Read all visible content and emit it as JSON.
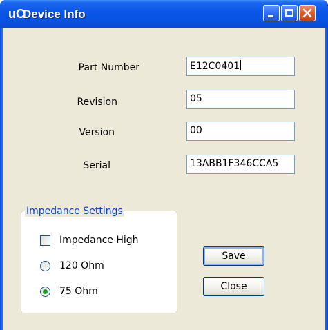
{
  "window": {
    "icon_text": "uC",
    "title": "Device Info"
  },
  "fields": {
    "part_number": {
      "label": "Part Number",
      "value": "E12C0401"
    },
    "revision": {
      "label": "Revision",
      "value": "05"
    },
    "version": {
      "label": "Version",
      "value": "00"
    },
    "serial": {
      "label": "Serial",
      "value": "13ABB1F346CCA5"
    }
  },
  "impedance": {
    "legend": "Impedance Settings",
    "high_label": "Impedance High",
    "high_checked": false,
    "option_120_label": "120 Ohm",
    "option_75_label": "75 Ohm",
    "selected": "75 Ohm"
  },
  "buttons": {
    "save_label": "Save",
    "close_label": "Close"
  },
  "colors": {
    "titlebar": "#0a55e6",
    "client_bg": "#ece9d8",
    "group_legend": "#0046d5",
    "radio_dot": "#21a121"
  }
}
